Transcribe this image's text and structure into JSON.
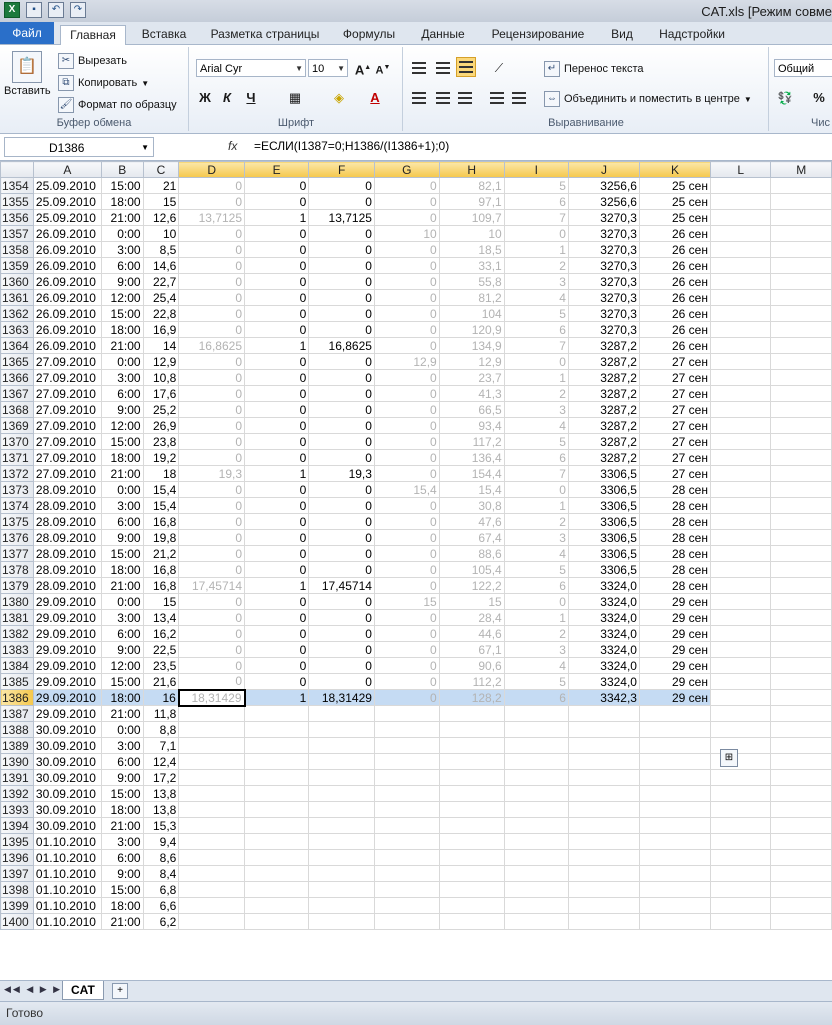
{
  "window": {
    "title": "CAT.xls  [Режим совме",
    "qat": [
      "save-icon",
      "undo-icon",
      "redo-icon"
    ]
  },
  "tabs": [
    "Файл",
    "Главная",
    "Вставка",
    "Разметка страницы",
    "Формулы",
    "Данные",
    "Рецензирование",
    "Вид",
    "Надстройки"
  ],
  "ribbon": {
    "clipboard": {
      "paste": "Вставить",
      "cut": "Вырезать",
      "copy": "Копировать",
      "format_painter": "Формат по образцу",
      "label": "Буфер обмена"
    },
    "font": {
      "name": "Arial Cyr",
      "size": "10",
      "bold": "Ж",
      "italic": "К",
      "underline": "Ч",
      "label": "Шрифт"
    },
    "alignment": {
      "wrap": "Перенос текста",
      "merge": "Объединить и поместить в центре",
      "label": "Выравнивание"
    },
    "number": {
      "format": "Общий",
      "percent": "%"
    },
    "partial_label": "Чис"
  },
  "formula_bar": {
    "name_box": "D1386",
    "fx": "fx",
    "formula": "=ЕСЛИ(I1387=0;H1386/(I1386+1);0)"
  },
  "columns": [
    "A",
    "B",
    "C",
    "D",
    "E",
    "F",
    "G",
    "H",
    "I",
    "J",
    "K",
    "L",
    "M"
  ],
  "selected_row": "1386",
  "rows": [
    [
      "1354",
      "25.09.2010",
      "15:00",
      "21",
      "0",
      "0",
      "0",
      "0",
      "82,1",
      "5",
      "3256,6",
      "25 сен"
    ],
    [
      "1355",
      "25.09.2010",
      "18:00",
      "15",
      "0",
      "0",
      "0",
      "0",
      "97,1",
      "6",
      "3256,6",
      "25 сен"
    ],
    [
      "1356",
      "25.09.2010",
      "21:00",
      "12,6",
      "13,7125",
      "1",
      "13,7125",
      "0",
      "109,7",
      "7",
      "3270,3",
      "25 сен"
    ],
    [
      "1357",
      "26.09.2010",
      "0:00",
      "10",
      "0",
      "0",
      "0",
      "10",
      "10",
      "0",
      "3270,3",
      "26 сен"
    ],
    [
      "1358",
      "26.09.2010",
      "3:00",
      "8,5",
      "0",
      "0",
      "0",
      "0",
      "18,5",
      "1",
      "3270,3",
      "26 сен"
    ],
    [
      "1359",
      "26.09.2010",
      "6:00",
      "14,6",
      "0",
      "0",
      "0",
      "0",
      "33,1",
      "2",
      "3270,3",
      "26 сен"
    ],
    [
      "1360",
      "26.09.2010",
      "9:00",
      "22,7",
      "0",
      "0",
      "0",
      "0",
      "55,8",
      "3",
      "3270,3",
      "26 сен"
    ],
    [
      "1361",
      "26.09.2010",
      "12:00",
      "25,4",
      "0",
      "0",
      "0",
      "0",
      "81,2",
      "4",
      "3270,3",
      "26 сен"
    ],
    [
      "1362",
      "26.09.2010",
      "15:00",
      "22,8",
      "0",
      "0",
      "0",
      "0",
      "104",
      "5",
      "3270,3",
      "26 сен"
    ],
    [
      "1363",
      "26.09.2010",
      "18:00",
      "16,9",
      "0",
      "0",
      "0",
      "0",
      "120,9",
      "6",
      "3270,3",
      "26 сен"
    ],
    [
      "1364",
      "26.09.2010",
      "21:00",
      "14",
      "16,8625",
      "1",
      "16,8625",
      "0",
      "134,9",
      "7",
      "3287,2",
      "26 сен"
    ],
    [
      "1365",
      "27.09.2010",
      "0:00",
      "12,9",
      "0",
      "0",
      "0",
      "12,9",
      "12,9",
      "0",
      "3287,2",
      "27 сен"
    ],
    [
      "1366",
      "27.09.2010",
      "3:00",
      "10,8",
      "0",
      "0",
      "0",
      "0",
      "23,7",
      "1",
      "3287,2",
      "27 сен"
    ],
    [
      "1367",
      "27.09.2010",
      "6:00",
      "17,6",
      "0",
      "0",
      "0",
      "0",
      "41,3",
      "2",
      "3287,2",
      "27 сен"
    ],
    [
      "1368",
      "27.09.2010",
      "9:00",
      "25,2",
      "0",
      "0",
      "0",
      "0",
      "66,5",
      "3",
      "3287,2",
      "27 сен"
    ],
    [
      "1369",
      "27.09.2010",
      "12:00",
      "26,9",
      "0",
      "0",
      "0",
      "0",
      "93,4",
      "4",
      "3287,2",
      "27 сен"
    ],
    [
      "1370",
      "27.09.2010",
      "15:00",
      "23,8",
      "0",
      "0",
      "0",
      "0",
      "117,2",
      "5",
      "3287,2",
      "27 сен"
    ],
    [
      "1371",
      "27.09.2010",
      "18:00",
      "19,2",
      "0",
      "0",
      "0",
      "0",
      "136,4",
      "6",
      "3287,2",
      "27 сен"
    ],
    [
      "1372",
      "27.09.2010",
      "21:00",
      "18",
      "19,3",
      "1",
      "19,3",
      "0",
      "154,4",
      "7",
      "3306,5",
      "27 сен"
    ],
    [
      "1373",
      "28.09.2010",
      "0:00",
      "15,4",
      "0",
      "0",
      "0",
      "15,4",
      "15,4",
      "0",
      "3306,5",
      "28 сен"
    ],
    [
      "1374",
      "28.09.2010",
      "3:00",
      "15,4",
      "0",
      "0",
      "0",
      "0",
      "30,8",
      "1",
      "3306,5",
      "28 сен"
    ],
    [
      "1375",
      "28.09.2010",
      "6:00",
      "16,8",
      "0",
      "0",
      "0",
      "0",
      "47,6",
      "2",
      "3306,5",
      "28 сен"
    ],
    [
      "1376",
      "28.09.2010",
      "9:00",
      "19,8",
      "0",
      "0",
      "0",
      "0",
      "67,4",
      "3",
      "3306,5",
      "28 сен"
    ],
    [
      "1377",
      "28.09.2010",
      "15:00",
      "21,2",
      "0",
      "0",
      "0",
      "0",
      "88,6",
      "4",
      "3306,5",
      "28 сен"
    ],
    [
      "1378",
      "28.09.2010",
      "18:00",
      "16,8",
      "0",
      "0",
      "0",
      "0",
      "105,4",
      "5",
      "3306,5",
      "28 сен"
    ],
    [
      "1379",
      "28.09.2010",
      "21:00",
      "16,8",
      "17,45714",
      "1",
      "17,45714",
      "0",
      "122,2",
      "6",
      "3324,0",
      "28 сен"
    ],
    [
      "1380",
      "29.09.2010",
      "0:00",
      "15",
      "0",
      "0",
      "0",
      "15",
      "15",
      "0",
      "3324,0",
      "29 сен"
    ],
    [
      "1381",
      "29.09.2010",
      "3:00",
      "13,4",
      "0",
      "0",
      "0",
      "0",
      "28,4",
      "1",
      "3324,0",
      "29 сен"
    ],
    [
      "1382",
      "29.09.2010",
      "6:00",
      "16,2",
      "0",
      "0",
      "0",
      "0",
      "44,6",
      "2",
      "3324,0",
      "29 сен"
    ],
    [
      "1383",
      "29.09.2010",
      "9:00",
      "22,5",
      "0",
      "0",
      "0",
      "0",
      "67,1",
      "3",
      "3324,0",
      "29 сен"
    ],
    [
      "1384",
      "29.09.2010",
      "12:00",
      "23,5",
      "0",
      "0",
      "0",
      "0",
      "90,6",
      "4",
      "3324,0",
      "29 сен"
    ],
    [
      "1385",
      "29.09.2010",
      "15:00",
      "21,6",
      "0",
      "0",
      "0",
      "0",
      "112,2",
      "5",
      "3324,0",
      "29 сен"
    ],
    [
      "1386",
      "29.09.2010",
      "18:00",
      "16",
      "18,31429",
      "1",
      "18,31429",
      "0",
      "128,2",
      "6",
      "3342,3",
      "29 сен"
    ],
    [
      "1387",
      "29.09.2010",
      "21:00",
      "11,8",
      "",
      "",
      "",
      "",
      "",
      "",
      "",
      ""
    ],
    [
      "1388",
      "30.09.2010",
      "0:00",
      "8,8",
      "",
      "",
      "",
      "",
      "",
      "",
      "",
      ""
    ],
    [
      "1389",
      "30.09.2010",
      "3:00",
      "7,1",
      "",
      "",
      "",
      "",
      "",
      "",
      "",
      ""
    ],
    [
      "1390",
      "30.09.2010",
      "6:00",
      "12,4",
      "",
      "",
      "",
      "",
      "",
      "",
      "",
      ""
    ],
    [
      "1391",
      "30.09.2010",
      "9:00",
      "17,2",
      "",
      "",
      "",
      "",
      "",
      "",
      "",
      ""
    ],
    [
      "1392",
      "30.09.2010",
      "15:00",
      "13,8",
      "",
      "",
      "",
      "",
      "",
      "",
      "",
      ""
    ],
    [
      "1393",
      "30.09.2010",
      "18:00",
      "13,8",
      "",
      "",
      "",
      "",
      "",
      "",
      "",
      ""
    ],
    [
      "1394",
      "30.09.2010",
      "21:00",
      "15,3",
      "",
      "",
      "",
      "",
      "",
      "",
      "",
      ""
    ],
    [
      "1395",
      "01.10.2010",
      "3:00",
      "9,4",
      "",
      "",
      "",
      "",
      "",
      "",
      "",
      ""
    ],
    [
      "1396",
      "01.10.2010",
      "6:00",
      "8,6",
      "",
      "",
      "",
      "",
      "",
      "",
      "",
      ""
    ],
    [
      "1397",
      "01.10.2010",
      "9:00",
      "8,4",
      "",
      "",
      "",
      "",
      "",
      "",
      "",
      ""
    ],
    [
      "1398",
      "01.10.2010",
      "15:00",
      "6,8",
      "",
      "",
      "",
      "",
      "",
      "",
      "",
      ""
    ],
    [
      "1399",
      "01.10.2010",
      "18:00",
      "6,6",
      "",
      "",
      "",
      "",
      "",
      "",
      "",
      ""
    ],
    [
      "1400",
      "01.10.2010",
      "21:00",
      "6,2",
      "",
      "",
      "",
      "",
      "",
      "",
      "",
      ""
    ]
  ],
  "sheet_tab": "CAT",
  "status": "Готово"
}
